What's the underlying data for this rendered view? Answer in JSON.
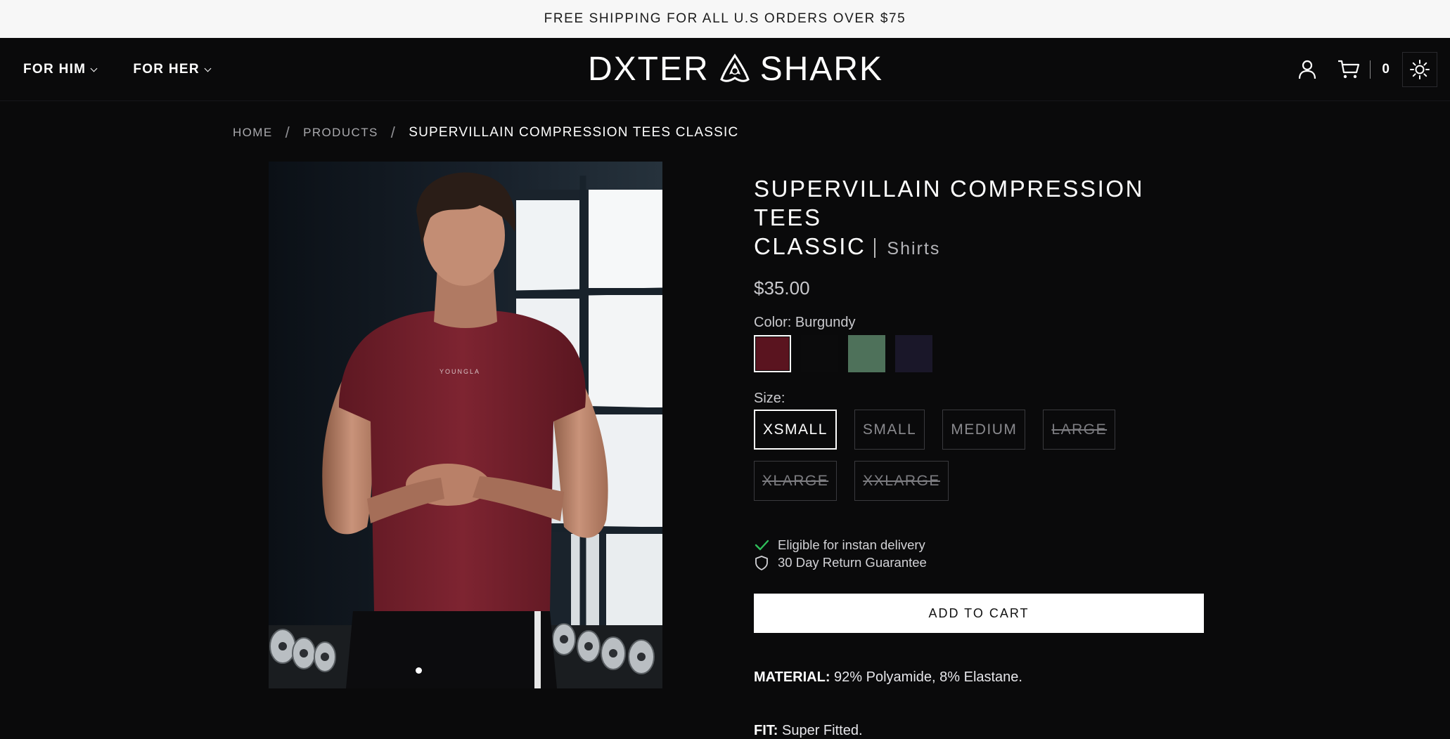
{
  "announcement": "FREE SHIPPING FOR ALL U.S ORDERS OVER $75",
  "nav": {
    "for_him": "FOR HIM",
    "for_her": "FOR HER"
  },
  "logo": {
    "left": "DXTER",
    "right": "SHARK",
    "icon": "shark-fin-icon"
  },
  "header_right": {
    "account_icon": "user-icon",
    "cart_icon": "cart-icon",
    "cart_count": "0",
    "theme_icon": "sun-icon"
  },
  "breadcrumb": {
    "home": "HOME",
    "products": "PRODUCTS",
    "current": "SUPERVILLAIN COMPRESSION TEES CLASSIC",
    "separator": "/"
  },
  "product": {
    "title_line1": "SUPERVILLAIN COMPRESSION TEES",
    "title_line2": "CLASSIC",
    "category": "Shirts",
    "price": "$35.00",
    "color_label": "Color: Burgundy",
    "shirt_print": "YOUNGLA",
    "colors": [
      {
        "name": "Burgundy",
        "hex": "#5a141f",
        "selected": true
      },
      {
        "name": "Black",
        "hex": "#0b0b0c",
        "selected": false
      },
      {
        "name": "Green",
        "hex": "#4e715a",
        "selected": false
      },
      {
        "name": "Navy",
        "hex": "#1a1729",
        "selected": false
      }
    ],
    "size_label": "Size:",
    "sizes": [
      {
        "label": "XSMALL",
        "state": "selected"
      },
      {
        "label": "SMALL",
        "state": "available"
      },
      {
        "label": "MEDIUM",
        "state": "available"
      },
      {
        "label": "LARGE",
        "state": "sold-out"
      },
      {
        "label": "XLARGE",
        "state": "sold-out"
      },
      {
        "label": "XXLARGE",
        "state": "sold-out"
      }
    ],
    "perks": {
      "delivery": "Eligible for instan delivery",
      "returns": "30 Day Return Guarantee"
    },
    "add_to_cart": "ADD TO CART",
    "material_label": "MATERIAL:",
    "material_value": " 92% Polyamide, 8% Elastane.",
    "fit_label": "FIT:",
    "fit_value": " Super Fitted."
  },
  "gallery": {
    "slide_count": 1,
    "active_slide": 1
  },
  "colors": {
    "accent_check": "#2fbf5a",
    "background": "#0a0a0b",
    "announcement_bg": "#f7f7f7"
  }
}
